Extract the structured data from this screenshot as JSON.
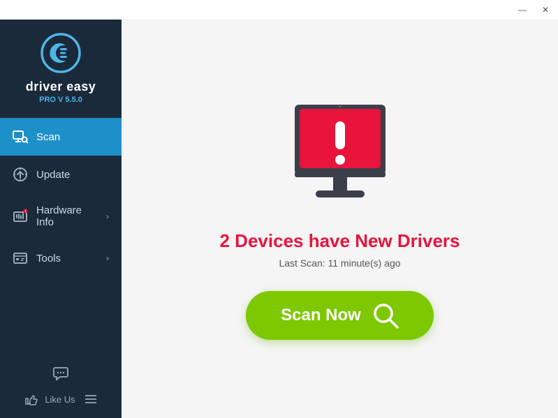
{
  "titlebar": {
    "minimize_label": "—",
    "close_label": "✕"
  },
  "sidebar": {
    "logo_text": "driver easy",
    "logo_version": "PRO V 5.5.0",
    "nav_items": [
      {
        "id": "scan",
        "label": "Scan",
        "active": true,
        "has_chevron": false
      },
      {
        "id": "update",
        "label": "Update",
        "active": false,
        "has_chevron": false
      },
      {
        "id": "hardware-info",
        "label": "Hardware Info",
        "active": false,
        "has_chevron": true
      },
      {
        "id": "tools",
        "label": "Tools",
        "active": false,
        "has_chevron": true
      }
    ],
    "like_us_label": "Like Us"
  },
  "main": {
    "headline": "2 Devices have New Drivers",
    "last_scan_label": "Last Scan: 11 minute(s) ago",
    "scan_button_label": "Scan Now"
  }
}
